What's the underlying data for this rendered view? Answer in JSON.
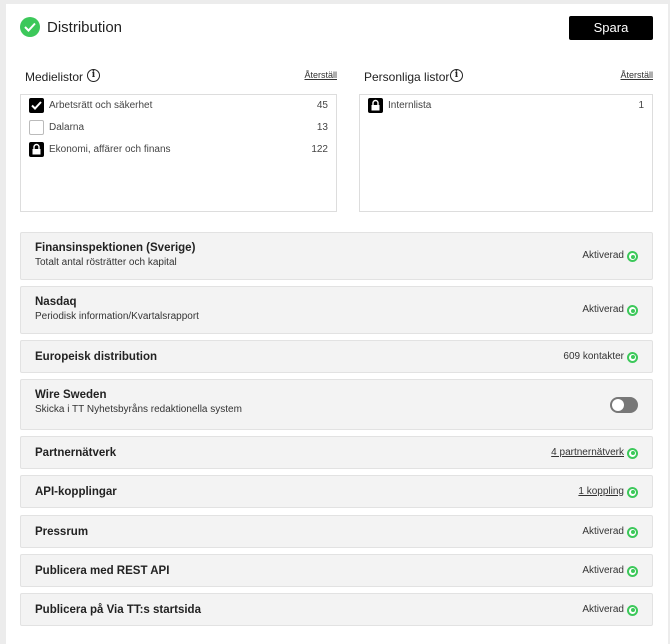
{
  "header": {
    "title": "Distribution",
    "save_label": "Spara"
  },
  "medialists": {
    "label": "Medielistor",
    "reset": "Återställ",
    "items": [
      {
        "name": "Arbetsrätt och säkerhet",
        "count": "45",
        "state": "checked"
      },
      {
        "name": "Dalarna",
        "count": "13",
        "state": "unchecked"
      },
      {
        "name": "Ekonomi, affärer och finans",
        "count": "122",
        "state": "locked"
      }
    ]
  },
  "personal": {
    "label": "Personliga listor",
    "reset": "Återställ",
    "items": [
      {
        "name": "Internlista",
        "count": "1",
        "state": "locked"
      }
    ]
  },
  "info_icon": "i",
  "channels": [
    {
      "title": "Finansinspektionen (Sverige)",
      "subtitle": "Totalt antal rösträtter och kapital",
      "status": "Aktiverad",
      "status_type": "text",
      "control": "dot"
    },
    {
      "title": "Nasdaq",
      "subtitle": "Periodisk information/Kvartalsrapport",
      "status": "Aktiverad",
      "status_type": "text",
      "control": "dot"
    },
    {
      "title": "Europeisk distribution",
      "subtitle": "",
      "status": "609 kontakter",
      "status_type": "text",
      "control": "dot"
    },
    {
      "title": "Wire Sweden",
      "subtitle": "Skicka i TT Nyhetsbyråns redaktionella system",
      "status": "",
      "status_type": "none",
      "control": "toggle-off"
    },
    {
      "title": "Partnernätverk",
      "subtitle": "",
      "status": "4 partnernätverk",
      "status_type": "link",
      "control": "dot"
    },
    {
      "title": "API-kopplingar",
      "subtitle": "",
      "status": "1 koppling",
      "status_type": "link",
      "control": "dot"
    },
    {
      "title": "Pressrum",
      "subtitle": "",
      "status": "Aktiverad",
      "status_type": "text",
      "control": "dot"
    },
    {
      "title": "Publicera med REST API",
      "subtitle": "",
      "status": "Aktiverad",
      "status_type": "text",
      "control": "dot"
    },
    {
      "title": "Publicera på Via TT:s startsida",
      "subtitle": "",
      "status": "Aktiverad",
      "status_type": "text",
      "control": "dot"
    }
  ],
  "colors": {
    "accent_green": "#3cc85a",
    "button_bg": "#000000",
    "row_bg": "#f3f3f3"
  },
  "icons": {
    "header": "check-circle-icon",
    "info": "info-icon",
    "lock": "lock-icon",
    "checkbox": "checkbox-checked-icon",
    "status": "status-dot-icon"
  }
}
